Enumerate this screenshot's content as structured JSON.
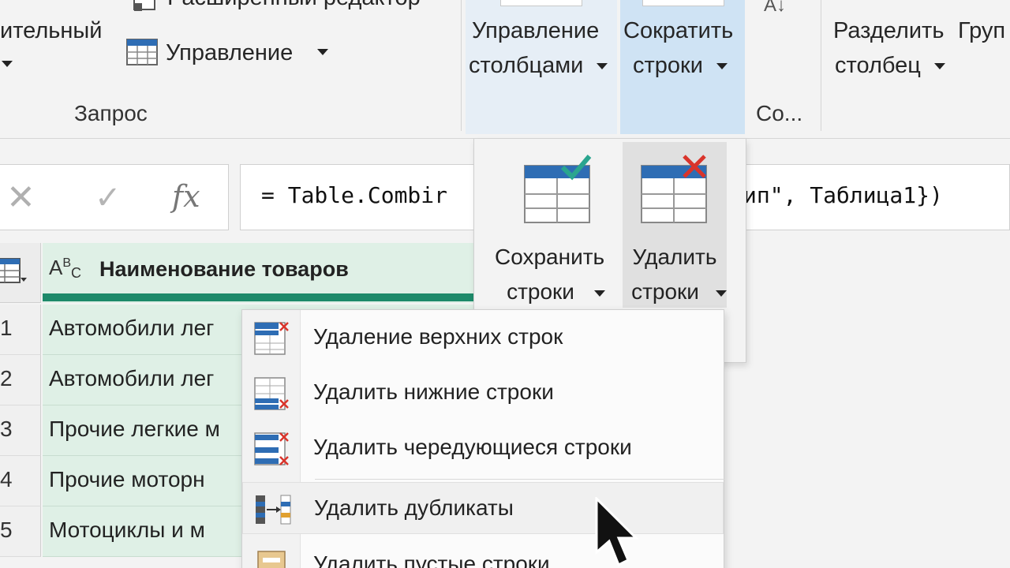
{
  "ribbon": {
    "advanced_editor_label": "Расширенный редактор",
    "partial_left_label": "ительный",
    "manage_label": "Управление",
    "query_group_label": "Запрос",
    "manage_columns_line1": "Управление",
    "manage_columns_line2": "столбцами",
    "reduce_rows_line1": "Сократить",
    "reduce_rows_line2": "строки",
    "sort_icon_text": "A↓",
    "sort_group_label": "Со...",
    "split_column_line1": "Разделить",
    "split_column_line2": "столбец",
    "group_partial_label": "Груп"
  },
  "formula_bar": {
    "cancel_icon": "x-icon",
    "confirm_icon": "check-icon",
    "fx_label": "fx",
    "formula_visible_left": "= Table.Combir",
    "formula_visible_right": "ип\", Таблица1})"
  },
  "grid": {
    "column_type_label": "ABC",
    "column_header": "Наименование товаров",
    "rows": [
      {
        "num": "1",
        "value": "Автомобили лег"
      },
      {
        "num": "2",
        "value": "Автомобили лег"
      },
      {
        "num": "3",
        "value": "Прочие легкие м"
      },
      {
        "num": "4",
        "value": "Прочие моторн"
      },
      {
        "num": "5",
        "value": "Мотоциклы и м"
      }
    ]
  },
  "flyout": {
    "keep_rows_line1": "Сохранить",
    "keep_rows_line2": "строки",
    "remove_rows_line1": "Удалить",
    "remove_rows_line2": "строки"
  },
  "menu": {
    "items": [
      {
        "label": "Удаление верхних строк",
        "icon": "remove-top-rows-icon"
      },
      {
        "label": "Удалить нижние строки",
        "icon": "remove-bottom-rows-icon"
      },
      {
        "label": "Удалить чередующиеся строки",
        "icon": "remove-alternate-rows-icon"
      },
      {
        "label": "Удалить дубликаты",
        "icon": "remove-duplicates-icon"
      },
      {
        "label": "Удалить пустые строки",
        "icon": "remove-blank-rows-icon"
      }
    ]
  },
  "colors": {
    "accent_blue": "#2e6db4",
    "selected_ribbon": "#cfe3f4",
    "column_green": "#dff0e6",
    "column_bar": "#1d8a6a",
    "remove_red": "#d9342b",
    "keep_teal": "#2aa58f"
  }
}
